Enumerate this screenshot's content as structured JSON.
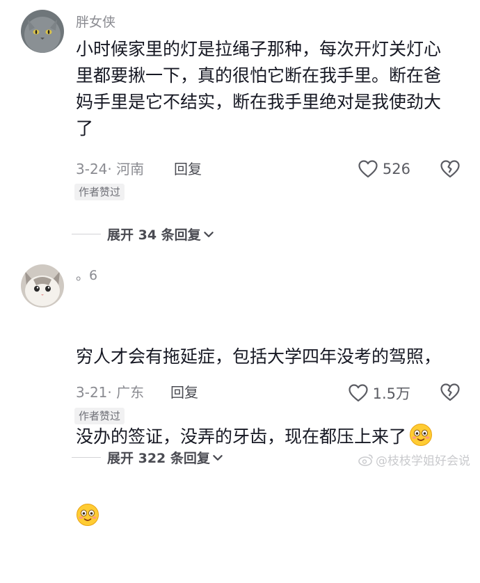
{
  "comments": [
    {
      "username": "胖女侠",
      "text": "小时候家里的灯是拉绳子那种，每次开灯关灯心\n里都要揪一下，真的很怕它断在我手里。断在爸\n妈手里是它不结实，断在我手里绝对是我使劲大\n了",
      "date_location": "3-24· 河南",
      "reply_label": "回复",
      "like_count": "526",
      "badge": "作者赞过",
      "expand_label": "展开 34 条回复",
      "avatar_icon": "gray-cat-avatar"
    },
    {
      "username": "。6",
      "text_line1": "穷人才会有拖延症，包括大学四年没考的驾照，",
      "text_line2": "没办的签证，没弄的牙齿，现在都压上来了",
      "emoji_icon": "blushing-face-emoji",
      "date_location": "3-21· 广东",
      "reply_label": "回复",
      "like_count": "1.5万",
      "badge": "作者赞过",
      "expand_label": "展开 322 条回复",
      "avatar_icon": "white-cat-avatar"
    }
  ],
  "watermark": "@枝枝学姐好会说",
  "colors": {
    "text": "#161823",
    "muted": "#8a8b91",
    "badge_bg": "#f1f1f2",
    "emoji": "#ffcc33"
  }
}
